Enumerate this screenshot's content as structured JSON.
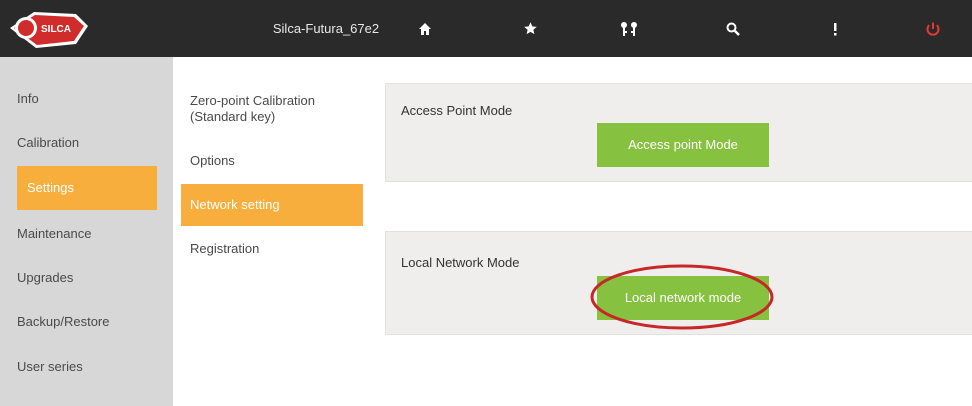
{
  "header": {
    "brand": "SILCA",
    "device_name": "Silca-Futura_67e2",
    "icons": [
      "home-icon",
      "star-icon",
      "keys-icon",
      "search-icon",
      "info-icon",
      "power-icon"
    ],
    "accent_color": "#2a2a2a",
    "power_color": "#e53935"
  },
  "sidebar": {
    "items": [
      {
        "label": "Info"
      },
      {
        "label": "Calibration"
      },
      {
        "label": "Settings",
        "active": true
      },
      {
        "label": "Maintenance"
      },
      {
        "label": "Upgrades"
      },
      {
        "label": "Backup/Restore"
      },
      {
        "label": "User series"
      }
    ],
    "active_color": "#f7ae3c"
  },
  "submenu": {
    "items": [
      {
        "label": "Zero-point Calibration (Standard key)"
      },
      {
        "label": "Options"
      },
      {
        "label": "Network setting",
        "active": true
      },
      {
        "label": "Registration"
      }
    ]
  },
  "panels": {
    "access_point": {
      "title": "Access Point Mode",
      "button_label": "Access point Mode"
    },
    "local_network": {
      "title": "Local Network Mode",
      "button_label": "Local network mode"
    },
    "button_color": "#86c13f",
    "highlight_color": "#c62828"
  }
}
